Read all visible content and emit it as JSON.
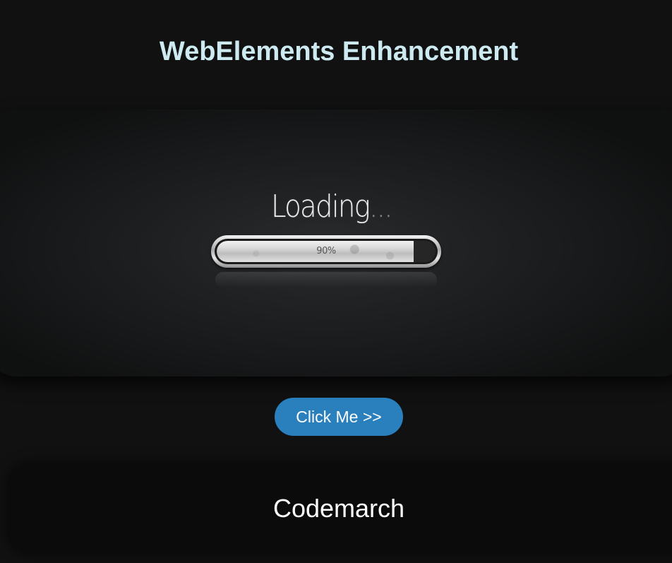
{
  "header": {
    "title": "WebElements Enhancement"
  },
  "hero": {
    "loading_label": "Loading",
    "loading_dots": "...",
    "progress_percent_label": "90%",
    "progress_value": 0.9
  },
  "action": {
    "button_label": "Click Me >>",
    "button_color": "#2a7fbd"
  },
  "footer": {
    "brand": "Codemarch"
  },
  "colors": {
    "background": "#111112",
    "title": "#cdeaf0"
  }
}
